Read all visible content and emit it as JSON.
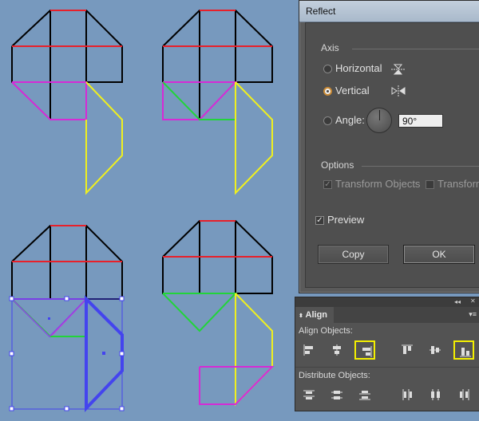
{
  "reflect_dialog": {
    "title": "Reflect",
    "axis_label": "Axis",
    "horizontal_label": "Horizontal",
    "vertical_label": "Vertical",
    "angle_label": "Angle:",
    "angle_value": "90°",
    "selected_axis": "Vertical",
    "options_label": "Options",
    "transform_objects_label": "Transform Objects",
    "transform_patterns_label": "Transform",
    "preview_label": "Preview",
    "preview_checked": true,
    "copy_label": "Copy",
    "ok_label": "OK"
  },
  "align_panel": {
    "tab_label": "Align",
    "align_objects_label": "Align Objects:",
    "distribute_objects_label": "Distribute Objects:",
    "collapse_icon": "double-chevron-left",
    "close_icon": "close-x",
    "menu_icon": "panel-menu",
    "align_icons": [
      "horizontal-align-left",
      "horizontal-align-center",
      "horizontal-align-right",
      "vertical-align-top",
      "vertical-align-center",
      "vertical-align-bottom"
    ],
    "distribute_icons": [
      "vertical-distribute-top",
      "vertical-distribute-center",
      "vertical-distribute-bottom",
      "horizontal-distribute-left",
      "horizontal-distribute-center",
      "horizontal-distribute-right"
    ],
    "highlighted": [
      "horizontal-align-right",
      "vertical-align-bottom"
    ],
    "highlight_color": "#f4f000"
  },
  "canvas": {
    "background_color": "#7799be",
    "stroke_colors": {
      "outline": "#000000",
      "red": "#e8202a",
      "magenta": "#d62ad6",
      "yellow": "#f0f01e",
      "green": "#22d43a",
      "selection_blue": "#4444ee"
    }
  }
}
